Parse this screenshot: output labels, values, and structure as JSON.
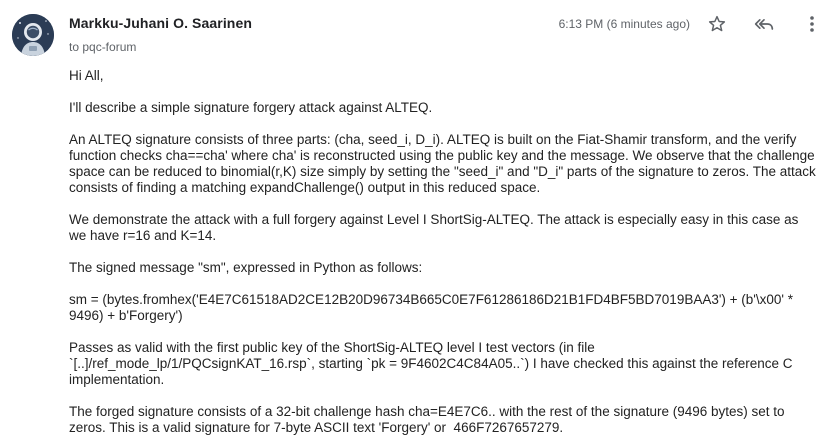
{
  "message": {
    "sender": "Markku-Juhani O. Saarinen",
    "recipient": "to pqc-forum",
    "timestamp": "6:13 PM (6 minutes ago)",
    "paragraphs": [
      "Hi All,",
      "I'll describe a simple signature forgery attack against ALTEQ.",
      "An ALTEQ signature consists of three parts: (cha, seed_i, D_i). ALTEQ is built on the Fiat-Shamir transform, and the verify function checks cha==cha' where cha' is reconstructed using the public key and the message. We observe that the challenge space can be reduced to binomial(r,K) size simply by setting the \"seed_i\" and \"D_i\" parts of the signature to zeros. The attack consists of finding a matching expandChallenge() output in this reduced space.",
      "We demonstrate the attack with a full forgery against Level I ShortSig-ALTEQ. The attack is especially easy in this case as we have r=16 and K=14.",
      "The signed message \"sm\", expressed in Python as follows:",
      "sm = (bytes.fromhex('E4E7C61518AD2CE12B20D96734B665C0E7F61286186D21B1FD4BF5BD7019BAA3') + (b'\\x00' * 9496) + b'Forgery')",
      "Passes as valid with the first public key of the ShortSig-ALTEQ level I test vectors (in file `[..]/ref_mode_lp/1/PQCsignKAT_16.rsp`, starting `pk = 9F4602C4C84A05..`) I have checked this against the reference C implementation.",
      "The forged signature consists of a 32-bit challenge hash cha=E4E7C6.. with the rest of the signature (9496 bytes) set to zeros. This is a valid signature for 7-byte ASCII text 'Forgery' or  466F7267657279."
    ]
  },
  "icons": {
    "avatar": "avatar-photo",
    "star": "star-outline-icon",
    "reply_all": "reply-all-icon",
    "more": "more-vertical-icon"
  },
  "colors": {
    "sender": "#202124",
    "meta": "#5f6368",
    "body": "#222222"
  }
}
